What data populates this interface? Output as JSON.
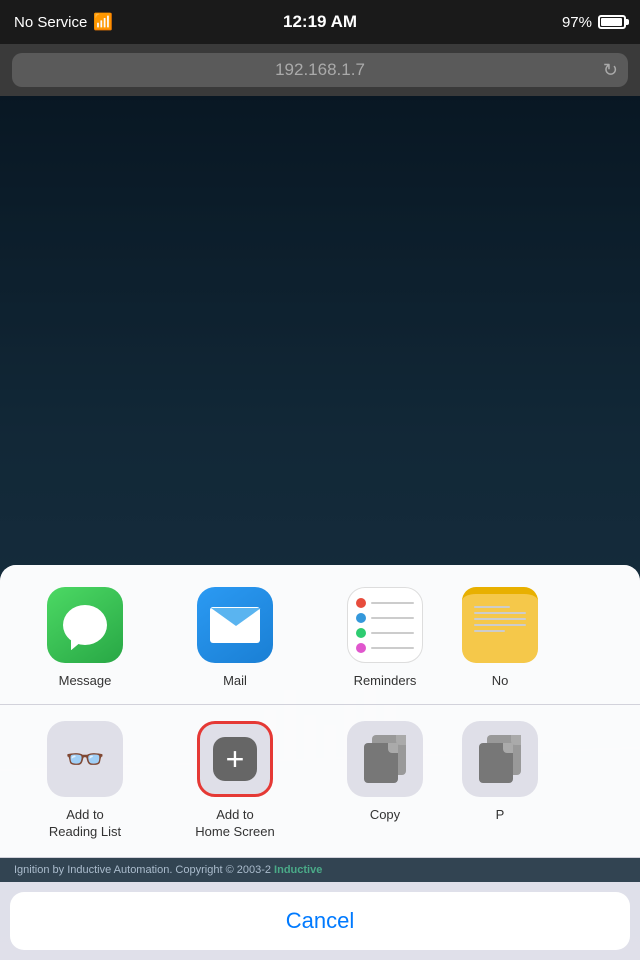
{
  "statusBar": {
    "noService": "No Service",
    "time": "12:19 AM",
    "battery": "97%",
    "wifiSymbol": "📶"
  },
  "addressBar": {
    "url": "192.168.1.7",
    "refreshSymbol": "↻"
  },
  "shareSheet": {
    "apps": [
      {
        "id": "message",
        "label": "Message"
      },
      {
        "id": "mail",
        "label": "Mail"
      },
      {
        "id": "reminders",
        "label": "Reminders"
      },
      {
        "id": "notes",
        "label": "No"
      }
    ],
    "actions": [
      {
        "id": "reading-list",
        "label": "Add to\nReading List",
        "highlighted": false
      },
      {
        "id": "add-home-screen",
        "label": "Add to\nHome Screen",
        "highlighted": true
      },
      {
        "id": "copy",
        "label": "Copy",
        "highlighted": false
      },
      {
        "id": "more",
        "label": "P",
        "highlighted": false
      }
    ],
    "cancelLabel": "Cancel",
    "footerText": "Ignition by Inductive Automation. Copyright © 2003-2",
    "footerLogoText": "Inductive"
  },
  "colors": {
    "accent": "#007aff",
    "highlightBorder": "#e53935",
    "messageGreen": "#4cd964",
    "mailBlue": "#2b9af3"
  }
}
